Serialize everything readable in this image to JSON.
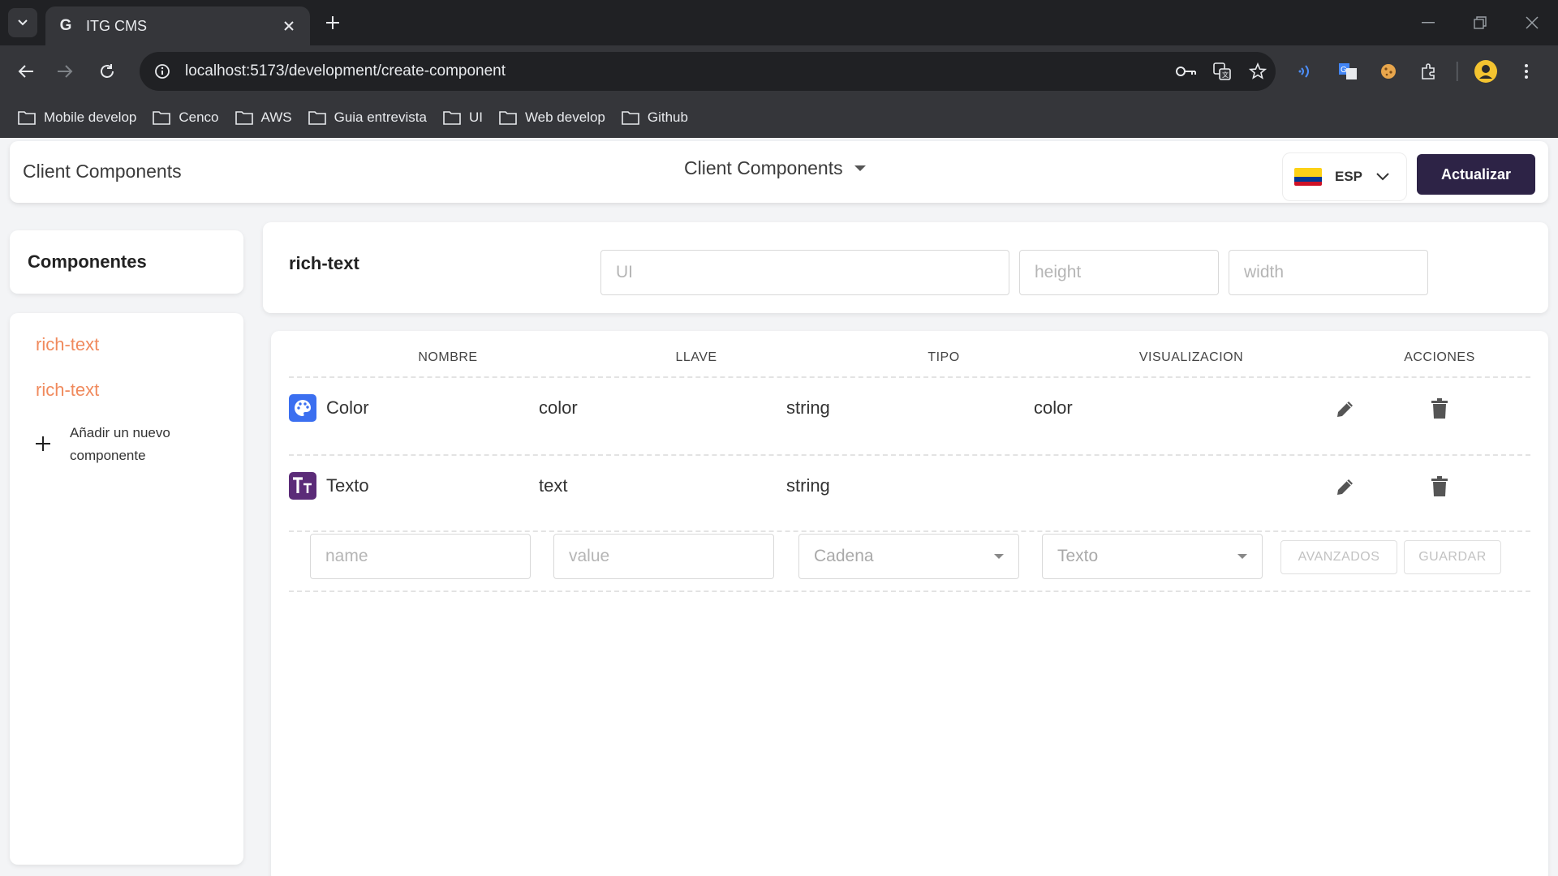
{
  "browser": {
    "tab_title": "ITG CMS",
    "favicon_letter": "G",
    "url": "localhost:5173/development/create-component",
    "bookmarks": [
      "Mobile develop",
      "Cenco",
      "AWS",
      "Guia entrevista",
      "UI",
      "Web develop",
      "Github"
    ]
  },
  "appbar": {
    "title": "Client Components",
    "project_select": "Client Components",
    "language": "ESP",
    "update_button": "Actualizar"
  },
  "sidebar": {
    "header": "Componentes",
    "items": [
      "rich-text",
      "rich-text"
    ],
    "add_label": "Añadir un nuevo componente"
  },
  "component": {
    "name": "rich-text",
    "ui_placeholder": "UI",
    "height_placeholder": "height",
    "width_placeholder": "width"
  },
  "table": {
    "headers": [
      "NOMBRE",
      "LLAVE",
      "TIPO",
      "VISUALIZACION",
      "ACCIONES"
    ],
    "rows": [
      {
        "icon": "palette-icon",
        "name": "Color",
        "key": "color",
        "type": "string",
        "display": "color"
      },
      {
        "icon": "text-format-icon",
        "name": "Texto",
        "key": "text",
        "type": "string",
        "display": ""
      }
    ],
    "new_row": {
      "name_placeholder": "name",
      "value_placeholder": "value",
      "type_select": "Cadena",
      "display_select": "Texto",
      "advanced_button": "AVANZADOS",
      "save_button": "GUARDAR"
    }
  },
  "colors": {
    "accent_button": "#2d2346",
    "sidebar_item": "#f08a5d",
    "palette_icon_bg": "#3b6ff0",
    "text_icon_bg": "#5b2b78"
  }
}
